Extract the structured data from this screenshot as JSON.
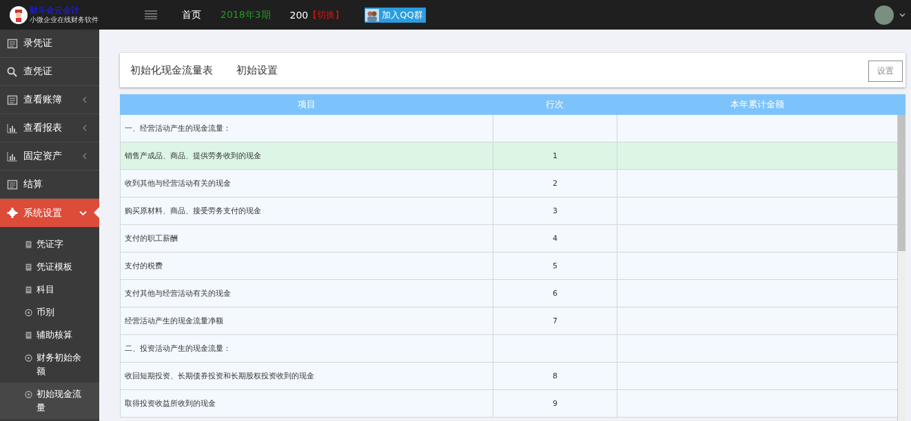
{
  "topbar": {
    "logo_title": "财斗金云会计",
    "logo_subtitle": "小微企业在线财务软件",
    "nav": [
      {
        "label": "首页",
        "kind": "plain"
      },
      {
        "label": "2018年3期",
        "kind": "period"
      },
      {
        "label": "200",
        "kind": "plain"
      },
      {
        "label": "【切换】",
        "kind": "switch"
      }
    ],
    "qq_button": "加入QQ群"
  },
  "sidebar": {
    "items": [
      {
        "label": "录凭证",
        "kind": "link",
        "selected": false
      },
      {
        "label": "查凭证",
        "kind": "link",
        "selected": false
      },
      {
        "label": "查看账簿",
        "kind": "menu",
        "expanded": false,
        "selected": false
      },
      {
        "label": "查看报表",
        "kind": "menu",
        "expanded": false,
        "selected": false
      },
      {
        "label": "固定资产",
        "kind": "menu",
        "expanded": false,
        "selected": false
      },
      {
        "label": "结算",
        "kind": "link",
        "selected": false
      },
      {
        "label": "系统设置",
        "kind": "menu",
        "expanded": true,
        "selected": true,
        "children": [
          {
            "label": "凭证字",
            "selected": false
          },
          {
            "label": "凭证模板",
            "selected": false
          },
          {
            "label": "科目",
            "selected": false
          },
          {
            "label": "币别",
            "selected": false
          },
          {
            "label": "辅助核算",
            "selected": false
          },
          {
            "label": "财务初始余额",
            "selected": false
          },
          {
            "label": "初始现金流量",
            "selected": true
          }
        ]
      }
    ]
  },
  "card": {
    "tabs": [
      "初始化现金流量表",
      "初始设置"
    ],
    "settings_button": "设置"
  },
  "table": {
    "columns": [
      "项目",
      "行次",
      "本年累计金额"
    ],
    "rows": [
      {
        "item": "一、经营活动产生的现金流量：",
        "line": "",
        "amount": "",
        "selected": false
      },
      {
        "item": "销售产成品、商品、提供劳务收到的现金",
        "line": "1",
        "amount": "",
        "selected": true
      },
      {
        "item": "收到其他与经营活动有关的现金",
        "line": "2",
        "amount": "",
        "selected": false
      },
      {
        "item": "购买原材料、商品、接受劳务支付的现金",
        "line": "3",
        "amount": "",
        "selected": false
      },
      {
        "item": "支付的职工薪酬",
        "line": "4",
        "amount": "",
        "selected": false
      },
      {
        "item": "支付的税费",
        "line": "5",
        "amount": "",
        "selected": false
      },
      {
        "item": "支付其他与经营活动有关的现金",
        "line": "6",
        "amount": "",
        "selected": false
      },
      {
        "item": "经营活动产生的现金流量净额",
        "line": "7",
        "amount": "",
        "selected": false
      },
      {
        "item": "二、投资活动产生的现金流量：",
        "line": "",
        "amount": "",
        "selected": false
      },
      {
        "item": "收回短期投资、长期债券投资和长期股权投资收到的现金",
        "line": "8",
        "amount": "",
        "selected": false
      },
      {
        "item": "取得投资收益所收到的现金",
        "line": "9",
        "amount": "",
        "selected": false
      }
    ]
  }
}
